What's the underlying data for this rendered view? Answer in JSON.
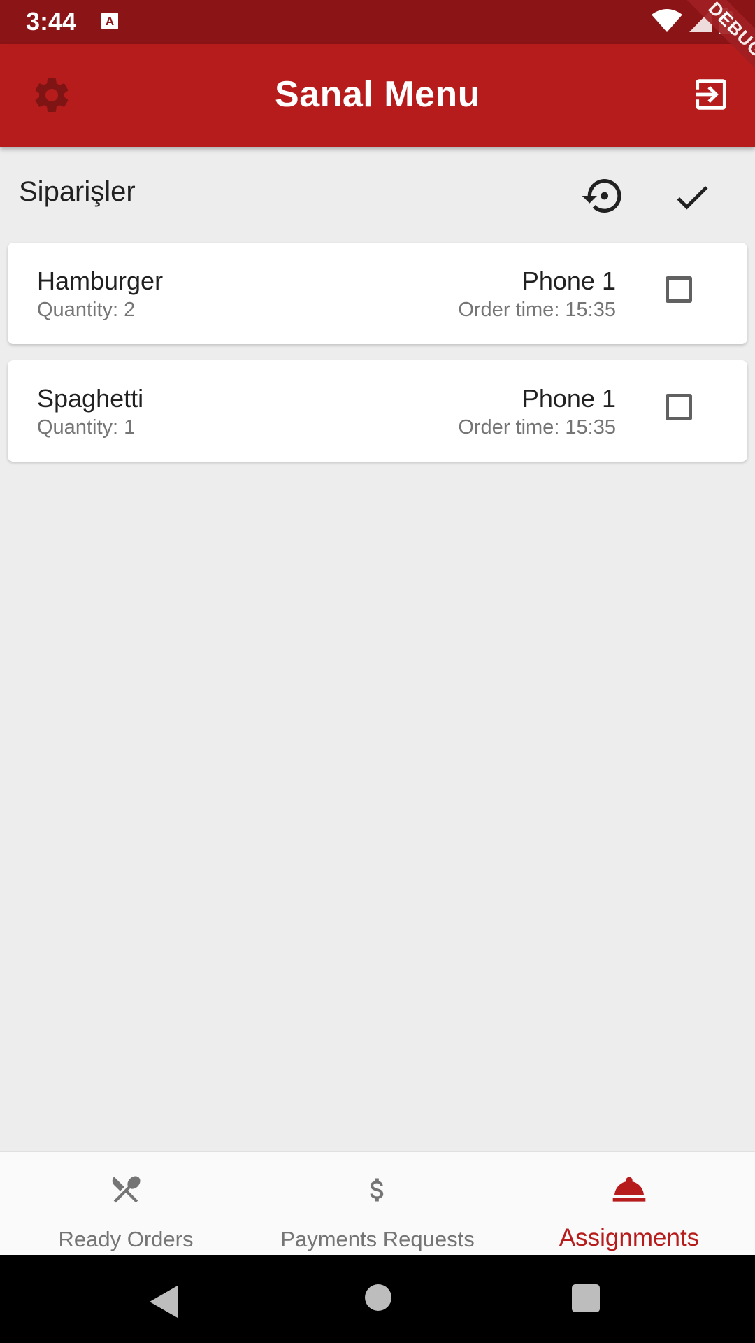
{
  "status_bar": {
    "time": "3:44"
  },
  "app_bar": {
    "title": "Sanal Menu",
    "debug_label": "DEBUG"
  },
  "section": {
    "title": "Siparişler"
  },
  "orders": [
    {
      "name": "Hamburger",
      "quantity": "Quantity: 2",
      "table": "Phone 1",
      "order_time": "Order time: 15:35",
      "checked": false
    },
    {
      "name": "Spaghetti",
      "quantity": "Quantity: 1",
      "table": "Phone 1",
      "order_time": "Order time: 15:35",
      "checked": false
    }
  ],
  "bottom_nav": {
    "items": [
      {
        "label": "Ready Orders",
        "icon": "utensils-icon",
        "active": false
      },
      {
        "label": "Payments Requests",
        "icon": "dollar-icon",
        "active": false
      },
      {
        "label": "Assignments",
        "icon": "room-service-icon",
        "active": true
      }
    ]
  },
  "colors": {
    "app_bar": "#b71c1c",
    "status_bar": "#8b1417",
    "accent": "#b71c1c",
    "background": "#ededed"
  }
}
